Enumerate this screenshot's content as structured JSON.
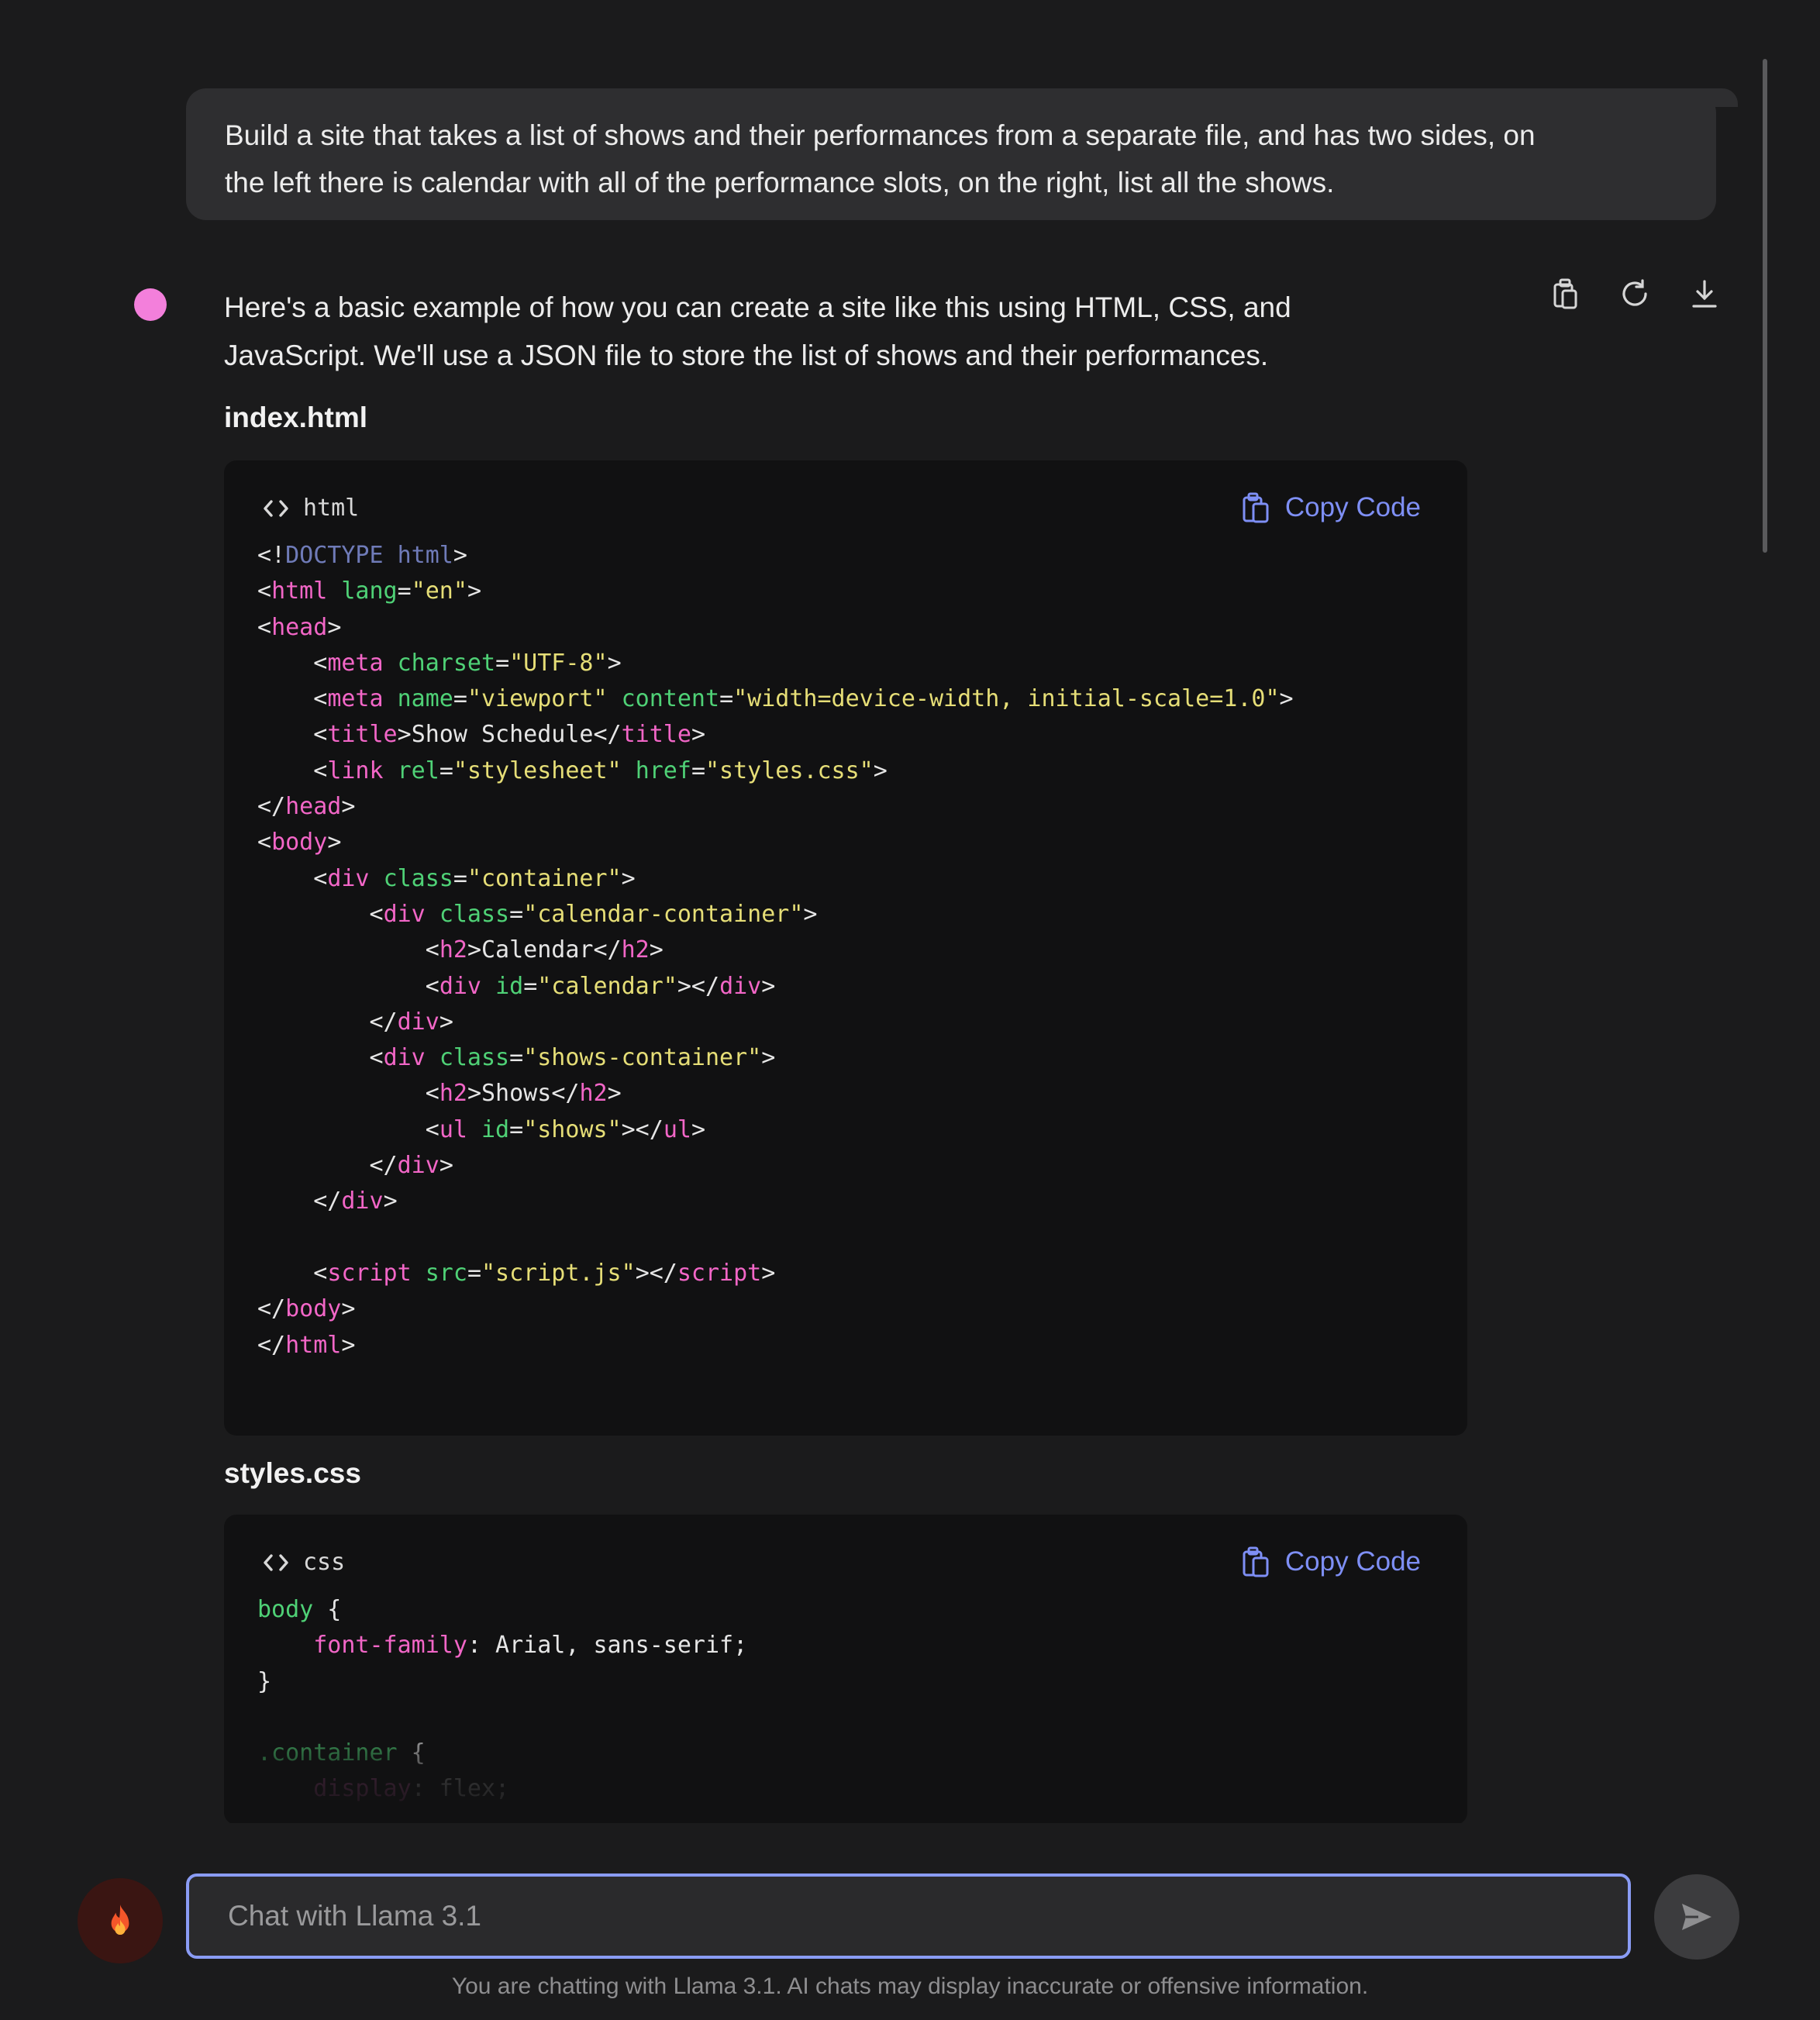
{
  "user_message": {
    "line1": "Build a site that takes a list of shows and their performances from a separate file, and has two sides, on",
    "line2": "the left there is calendar with all of the performance slots, on the right, list all the shows."
  },
  "assistant": {
    "intro_line1": "Here's a basic example of how you can create a site like this using HTML, CSS, and",
    "intro_line2": "JavaScript. We'll use a JSON file to store the list of shows and their performances.",
    "actions": [
      "copy-icon",
      "regenerate-icon",
      "download-icon"
    ],
    "files": [
      {
        "title": "index.html",
        "language": "html",
        "copy_label": "Copy Code"
      },
      {
        "title": "styles.css",
        "language": "css",
        "copy_label": "Copy Code"
      }
    ]
  },
  "composer": {
    "placeholder": "Chat with Llama 3.1",
    "avatar_icon": "fire-icon",
    "send_icon": "send-icon"
  },
  "disclaimer": "You are chatting with Llama 3.1. AI chats may display inaccurate or offensive information.",
  "colors": {
    "background": "#1b1b1c",
    "bubble": "#2e2e30",
    "code_bg": "#111112",
    "accent": "#7e8ff5",
    "bot_dot": "#f37fdb",
    "tag": "#f266c7",
    "attr": "#4fd176",
    "string": "#e6de77"
  }
}
